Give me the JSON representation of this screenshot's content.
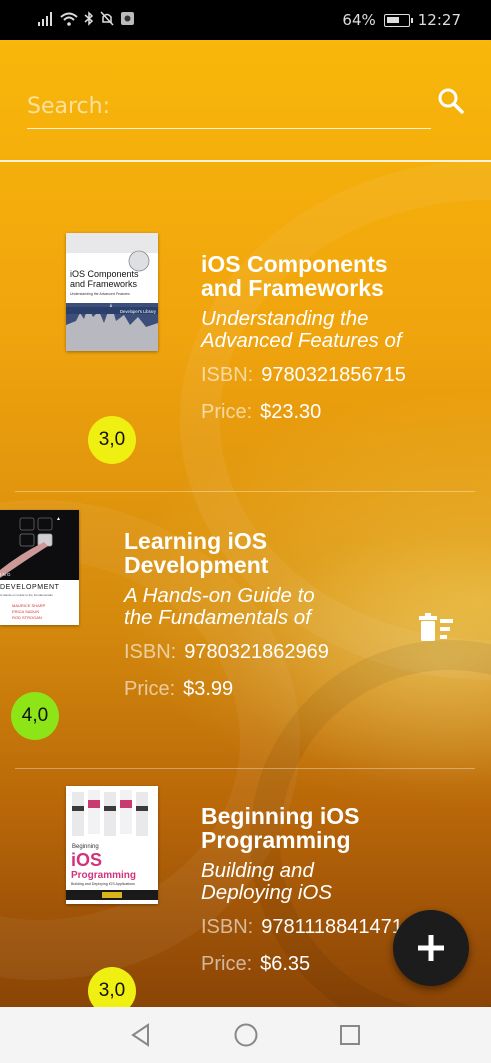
{
  "status_bar": {
    "battery": "64%",
    "battery_level": 0.64,
    "time": "12:27"
  },
  "search": {
    "placeholder": "Search:",
    "value": ""
  },
  "books": [
    {
      "title_line1": "iOS Components",
      "title_line2": "and Frameworks",
      "subtitle_line1": "Understanding the",
      "subtitle_line2": "Advanced Features of",
      "isbn_label": "ISBN:",
      "isbn": "9780321856715",
      "price_label": "Price:",
      "price": "$23.30",
      "rating": "3,0",
      "rating_color": "#f0ef12",
      "cover": {
        "top_text": "iOS Components and Frameworks",
        "sub_text": "Understanding the Advanced Features of the iOS SDK",
        "badge": "Developer's Library"
      }
    },
    {
      "title_line1": "Learning iOS",
      "title_line2": "Development",
      "subtitle_line1": "A Hands-on Guide to",
      "subtitle_line2": "the Fundamentals of",
      "isbn_label": "ISBN:",
      "isbn": "9780321862969",
      "price_label": "Price:",
      "price": "$3.99",
      "rating": "4,0",
      "rating_color": "#8de416",
      "cover": {
        "top_text": "ING DEVELOPMENT",
        "authors": "MAURICE SHARP · ERICA SADUN · ROD STROGAN"
      }
    },
    {
      "title_line1": "Beginning iOS",
      "title_line2": "Programming",
      "subtitle_line1": "Building and",
      "subtitle_line2": "Deploying iOS",
      "isbn_label": "ISBN:",
      "isbn": "9781118841471",
      "price_label": "Price:",
      "price": "$6.35",
      "rating": "3,0",
      "rating_color": "#f0ef12",
      "cover": {
        "top_text": "Beginning",
        "big_text": "iOS",
        "big_text2": "Programming",
        "sub_text": "Building and Deploying iOS Applications"
      }
    }
  ],
  "colors": {
    "accent": "#f8b70a",
    "fab": "#1c1c1c"
  },
  "icons": {
    "search": "search-icon",
    "delete": "delete-sweep-icon",
    "add": "plus-icon",
    "back": "back-triangle-icon",
    "home": "home-circle-icon",
    "recents": "recents-square-icon"
  }
}
